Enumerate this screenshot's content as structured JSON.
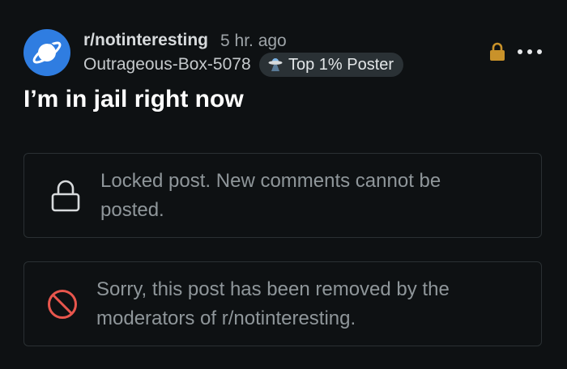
{
  "post": {
    "subreddit": "r/notinteresting",
    "time_ago": "5 hr. ago",
    "author": "Outrageous-Box-5078",
    "flair": "Top 1% Poster",
    "title": "I’m in jail right now"
  },
  "notices": {
    "locked": "Locked post. New comments cannot be posted.",
    "removed": "Sorry, this post has been removed by the moderators of r/notinteresting."
  },
  "icons": {
    "avatar": "planet-icon",
    "flair": "ufo-icon",
    "lock_badge": "lock-icon",
    "more": "more-options-icon",
    "locked_notice": "lock-outline-icon",
    "removed_notice": "prohibited-icon"
  },
  "colors": {
    "background": "#0e1113",
    "avatar": "#2f7de1",
    "lock_badge": "#c9922a",
    "removed_icon": "#e8564d",
    "notice_border": "#2a3033"
  }
}
